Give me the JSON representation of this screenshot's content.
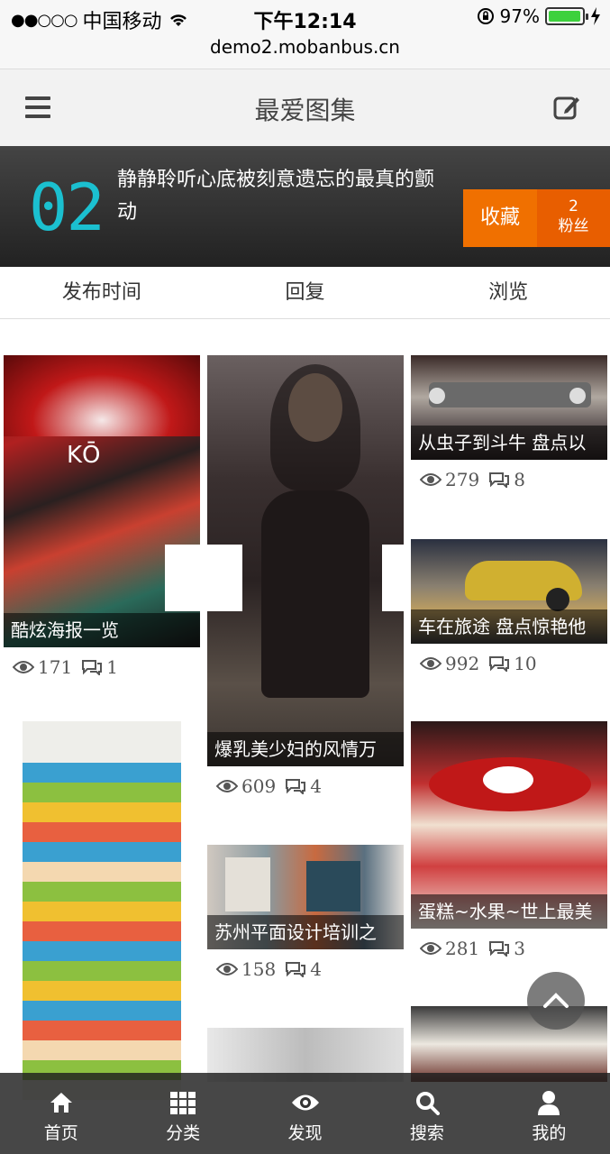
{
  "status_bar": {
    "carrier": "中国移动",
    "time": "下午12:14",
    "battery_text": "97%",
    "battery_level": 0.97,
    "url": "demo2.mobanbus.cn"
  },
  "header": {
    "title": "最爱图集",
    "menu_icon": "menu-icon",
    "edit_icon": "edit-icon"
  },
  "banner": {
    "number": "02",
    "text": "静静聆听心底被刻意遗忘的最真的颤动",
    "fav_label": "收藏",
    "fans_count": "2",
    "fans_label": "粉丝"
  },
  "tabs": [
    "发布时间",
    "回复",
    "浏览"
  ],
  "cards": [
    {
      "caption": "酷炫海报一览",
      "views": "171",
      "comments": "1"
    },
    {
      "caption": "爆乳美少妇的风情万",
      "views": "609",
      "comments": "4"
    },
    {
      "caption": "从虫子到斗牛 盘点以",
      "views": "279",
      "comments": "8"
    },
    {
      "caption": "车在旅途 盘点惊艳他",
      "views": "992",
      "comments": "10"
    },
    {
      "caption": "苏州平面设计培训之",
      "views": "158",
      "comments": "4"
    },
    {
      "caption": "蛋糕~水果~世上最美",
      "views": "281",
      "comments": "3"
    }
  ],
  "bottom_nav": [
    "首页",
    "分类",
    "发现",
    "搜索",
    "我的"
  ],
  "colors": {
    "accent_orange": "#f07000",
    "number_cyan": "#1bc0d0"
  }
}
